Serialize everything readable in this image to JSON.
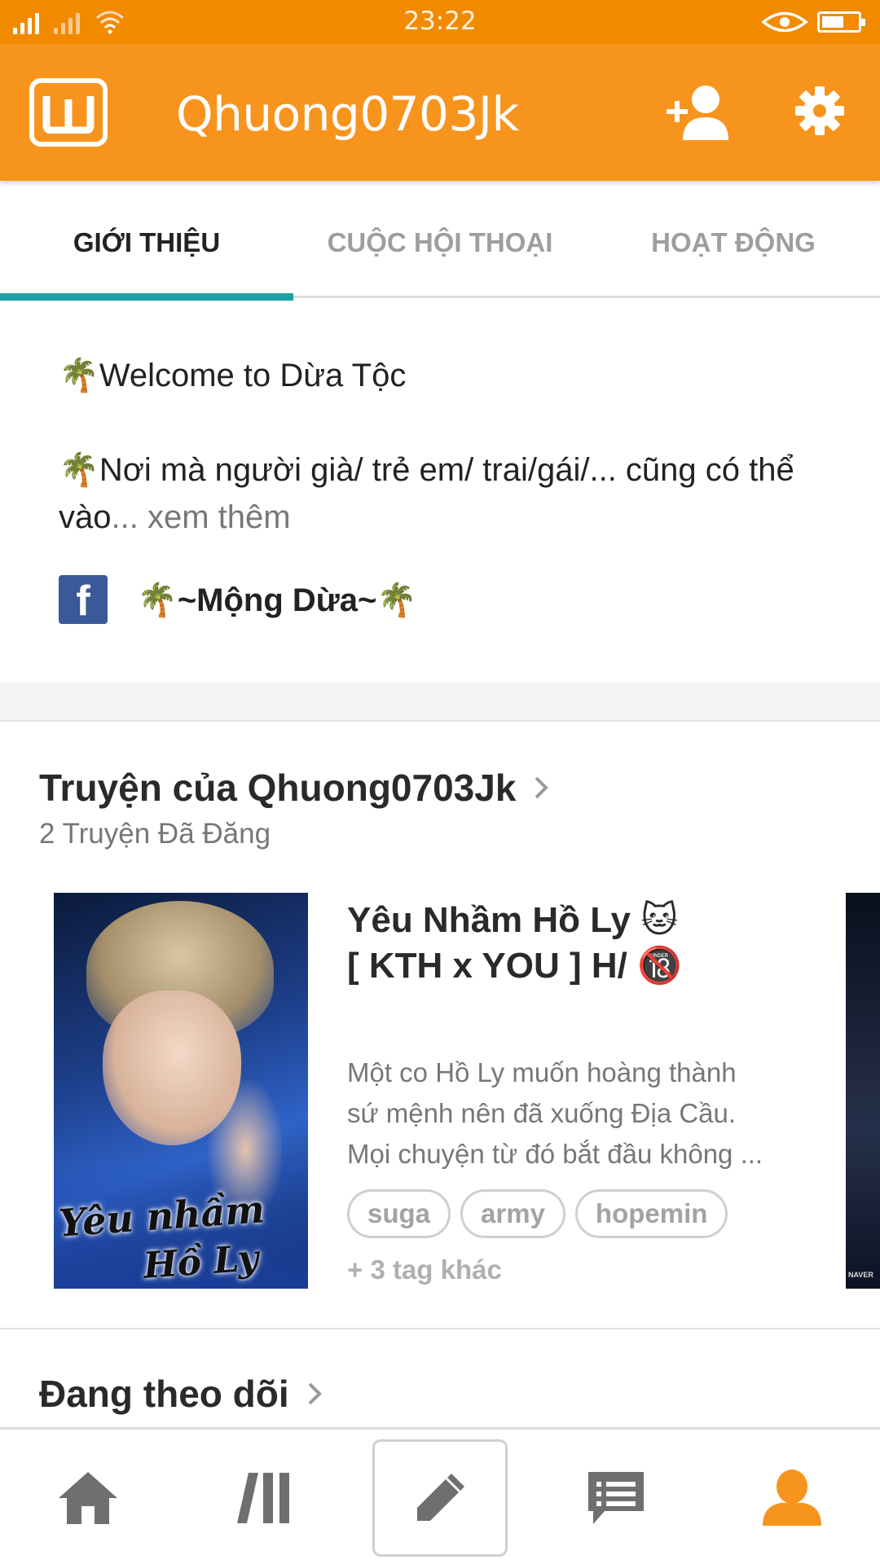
{
  "status_bar": {
    "time": "23:22",
    "battery_level": 0.55
  },
  "app_bar": {
    "title": "Qhuong0703Jk",
    "logo_icon": "wattpad-logo-icon",
    "actions": [
      "add-user-icon",
      "gear-icon"
    ],
    "color": "#f7941d"
  },
  "tabs": [
    {
      "label": "GIỚI THIỆU",
      "active": true
    },
    {
      "label": "CUỘC HỘI THOẠI",
      "active": false
    },
    {
      "label": "HOẠT ĐỘNG",
      "active": false
    }
  ],
  "intro": {
    "line1": "Welcome to Dừa Tộc",
    "line2": "Nơi mà người già/ trẻ em/ trai/gái/... cũng có thể vào",
    "ellipsis": "...",
    "more": " xem thêm",
    "palm": "🌴",
    "facebook_label": "~Mộng Dừa~"
  },
  "stories": {
    "title": "Truyện của Qhuong0703Jk",
    "subtitle": "2 Truyện Đã Đăng",
    "items": [
      {
        "title_line1": "Yêu Nhầm Hồ Ly",
        "title_emoji1": "🐱",
        "title_line2": "[ KTH x YOU ] H/",
        "title_emoji2": "🔞",
        "cover_caption1": "Yêu nhầm",
        "cover_caption2": "Hồ Ly",
        "description_lines": [
          "Một co Hồ Ly muốn hoàng thành",
          "sứ mệnh nên đã xuống Địa Cầu.",
          "Mọi chuyện từ đó bắt đầu không ..."
        ],
        "tags": [
          "suga",
          "army",
          "hopemin"
        ],
        "more_tags": "+ 3 tag khác"
      }
    ],
    "next_cover_caption": "NAVER"
  },
  "following": {
    "title": "Đang theo dõi"
  },
  "bottom_nav": {
    "items": [
      "home-icon",
      "library-icon",
      "write-icon",
      "messages-icon",
      "profile-icon"
    ],
    "active": "profile-icon",
    "active_color": "#f7941d",
    "inactive_color": "#6f6f6f"
  }
}
